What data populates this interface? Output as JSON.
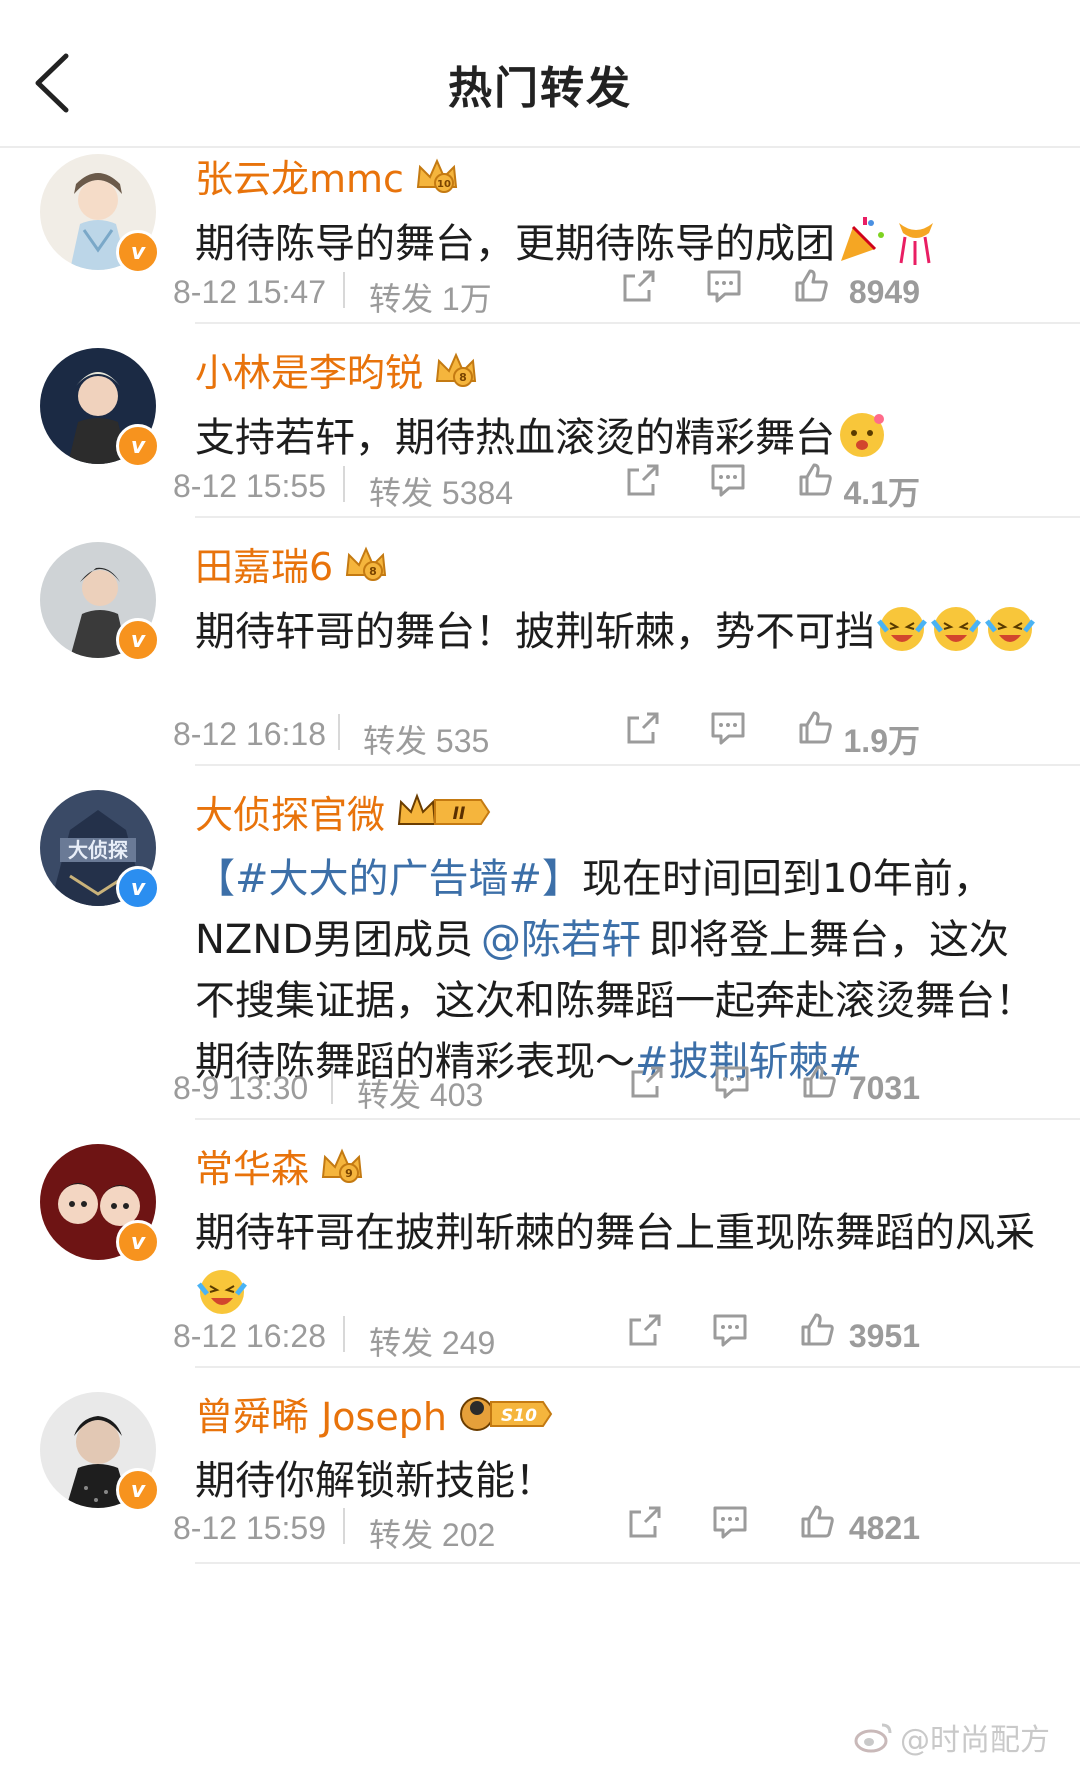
{
  "header": {
    "title": "热门转发",
    "back_icon": "chevron-left-icon"
  },
  "colors": {
    "name": "#e8730b",
    "link": "#3c6fa8",
    "meta": "#9b9b9b",
    "vip_orange": "#f7931e",
    "vip_blue": "#2b8ef0"
  },
  "posts": [
    {
      "name": "张云龙mmc",
      "badge": "orange",
      "text": "期待陈导的舞台，更期待陈导的成团",
      "time": "8-12 15:47",
      "reposts": "转发 1万",
      "likes": "8949"
    },
    {
      "name": "小林是李昀锐",
      "badge": "orange",
      "text": "支持若轩，期待热血滚烫的精彩舞台",
      "time": "8-12 15:55",
      "reposts": "转发 5384",
      "likes": "4.1万"
    },
    {
      "name": "田嘉瑞6",
      "badge": "orange",
      "text": "期待轩哥的舞台！披荆斩棘，势不可挡",
      "time": "8-12 16:18",
      "reposts": "转发 535",
      "likes": "1.9万"
    },
    {
      "name": "大侦探官微",
      "badge": "blue",
      "text_parts": {
        "tag1": "【#大大的广告墙#】",
        "t1": "现在时间回到10年前，NZND男团成员",
        "mention": "@陈若轩",
        "t2": "即将登上舞台，这次不搜集证据，这次和陈舞蹈一起奔赴滚烫舞台！期待陈舞蹈的精彩表现～",
        "tag2": "#披荆斩棘#"
      },
      "crown_level": "II",
      "time": "8-9 13:30",
      "reposts": "转发 403",
      "likes": "7031"
    },
    {
      "name": "常华森",
      "badge": "orange",
      "text": "期待轩哥在披荆斩棘的舞台上重现陈舞蹈的风采",
      "time": "8-12 16:28",
      "reposts": "转发 249",
      "likes": "3951"
    },
    {
      "name": "曾舜晞 Joseph",
      "badge": "orange",
      "crown_level": "S10",
      "text": "期待你解锁新技能！",
      "time": "8-12 15:59",
      "reposts": "转发 202",
      "likes": "4821"
    }
  ],
  "watermark": "@时尚配方"
}
